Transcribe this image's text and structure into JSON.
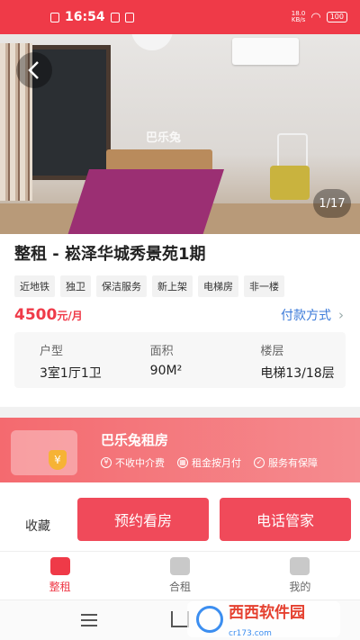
{
  "status_bar": {
    "time": "16:54",
    "speed_value": "18.0",
    "speed_unit": "KB/s",
    "battery": "100"
  },
  "gallery": {
    "watermark": "巴乐兔",
    "counter": "1/17"
  },
  "listing": {
    "title": "整租 - 崧泽华城秀景苑1期",
    "tags": [
      "近地铁",
      "独卫",
      "保洁服务",
      "新上架",
      "电梯房",
      "非一楼"
    ],
    "price": "4500",
    "price_unit": "元/月",
    "payment_link": "付款方式",
    "specs": [
      {
        "label": "户型",
        "value": "3室1厅1卫"
      },
      {
        "label": "面积",
        "value": "90M²"
      },
      {
        "label": "楼层",
        "value": "电梯13/18层"
      }
    ]
  },
  "banner": {
    "title": "巴乐兔租房",
    "features": [
      "不收中介费",
      "租金按月付",
      "服务有保障"
    ]
  },
  "actions": {
    "favorite": "收藏",
    "book_viewing": "预约看房",
    "call_manager": "电话管家"
  },
  "tabs": [
    {
      "label": "整租",
      "active": true
    },
    {
      "label": "合租",
      "active": false
    },
    {
      "label": "我的",
      "active": false
    }
  ],
  "watermark_logo": {
    "text": "西西软件园",
    "url": "cr173.com"
  }
}
